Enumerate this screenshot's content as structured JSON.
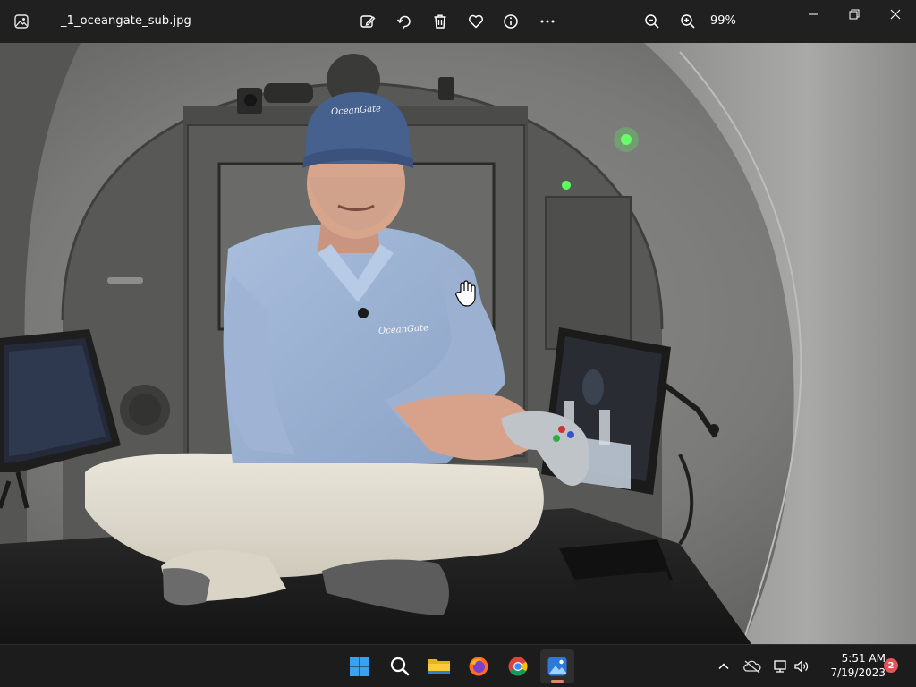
{
  "window": {
    "file_name": "_1_oceangate_sub.jpg",
    "zoom_level": "99%"
  },
  "toolbar": {
    "icons": [
      "edit-image-icon",
      "rotate-icon",
      "delete-icon",
      "favorite-icon",
      "info-icon",
      "more-icon",
      "zoom-out-icon",
      "zoom-in-icon"
    ]
  },
  "photo": {
    "cap_logo_text": "OceanGate",
    "shirt_logo_text": "OceanGate"
  },
  "taskbar": {
    "apps": [
      "start-icon",
      "search-icon",
      "file-explorer-icon",
      "firefox-icon",
      "chrome-icon",
      "photos-icon"
    ],
    "clock_time": "5:51 AM",
    "clock_date": "7/19/2023",
    "notification_count": "2"
  },
  "colors": {
    "accent": "#3a8fd8",
    "indicator": "#e8836b",
    "badge": "#e0545a"
  }
}
